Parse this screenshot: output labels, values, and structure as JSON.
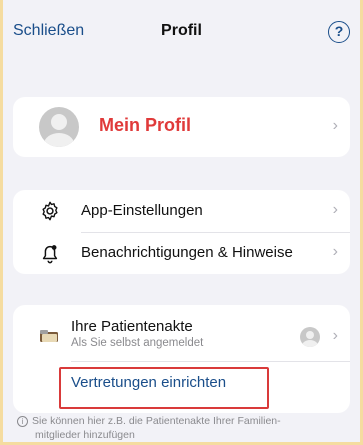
{
  "navbar": {
    "close_label": "Schließen",
    "title": "Profil",
    "help_icon": "?"
  },
  "profile": {
    "label": "Mein Profil",
    "label_color": "#e03a3a"
  },
  "settings": {
    "items": [
      {
        "label": "App-Einstellungen",
        "icon": "gear-icon"
      },
      {
        "label": "Benachrichtigungen & Hinweise",
        "icon": "bell-icon"
      }
    ]
  },
  "akte": {
    "title": "Ihre Patientenakte",
    "subtitle": "Als Sie selbst angemeldet",
    "action_label": "Vertretungen einrichten"
  },
  "footnote": {
    "line1": "Sie können hier z.B. die Patientenakte Ihrer Familien-",
    "line2": "mitglieder hinzufügen"
  },
  "chevron": "›",
  "colors": {
    "accent": "#1a4e8a",
    "highlight_border": "#d93a3a",
    "background_frame": "#f5dca0"
  }
}
